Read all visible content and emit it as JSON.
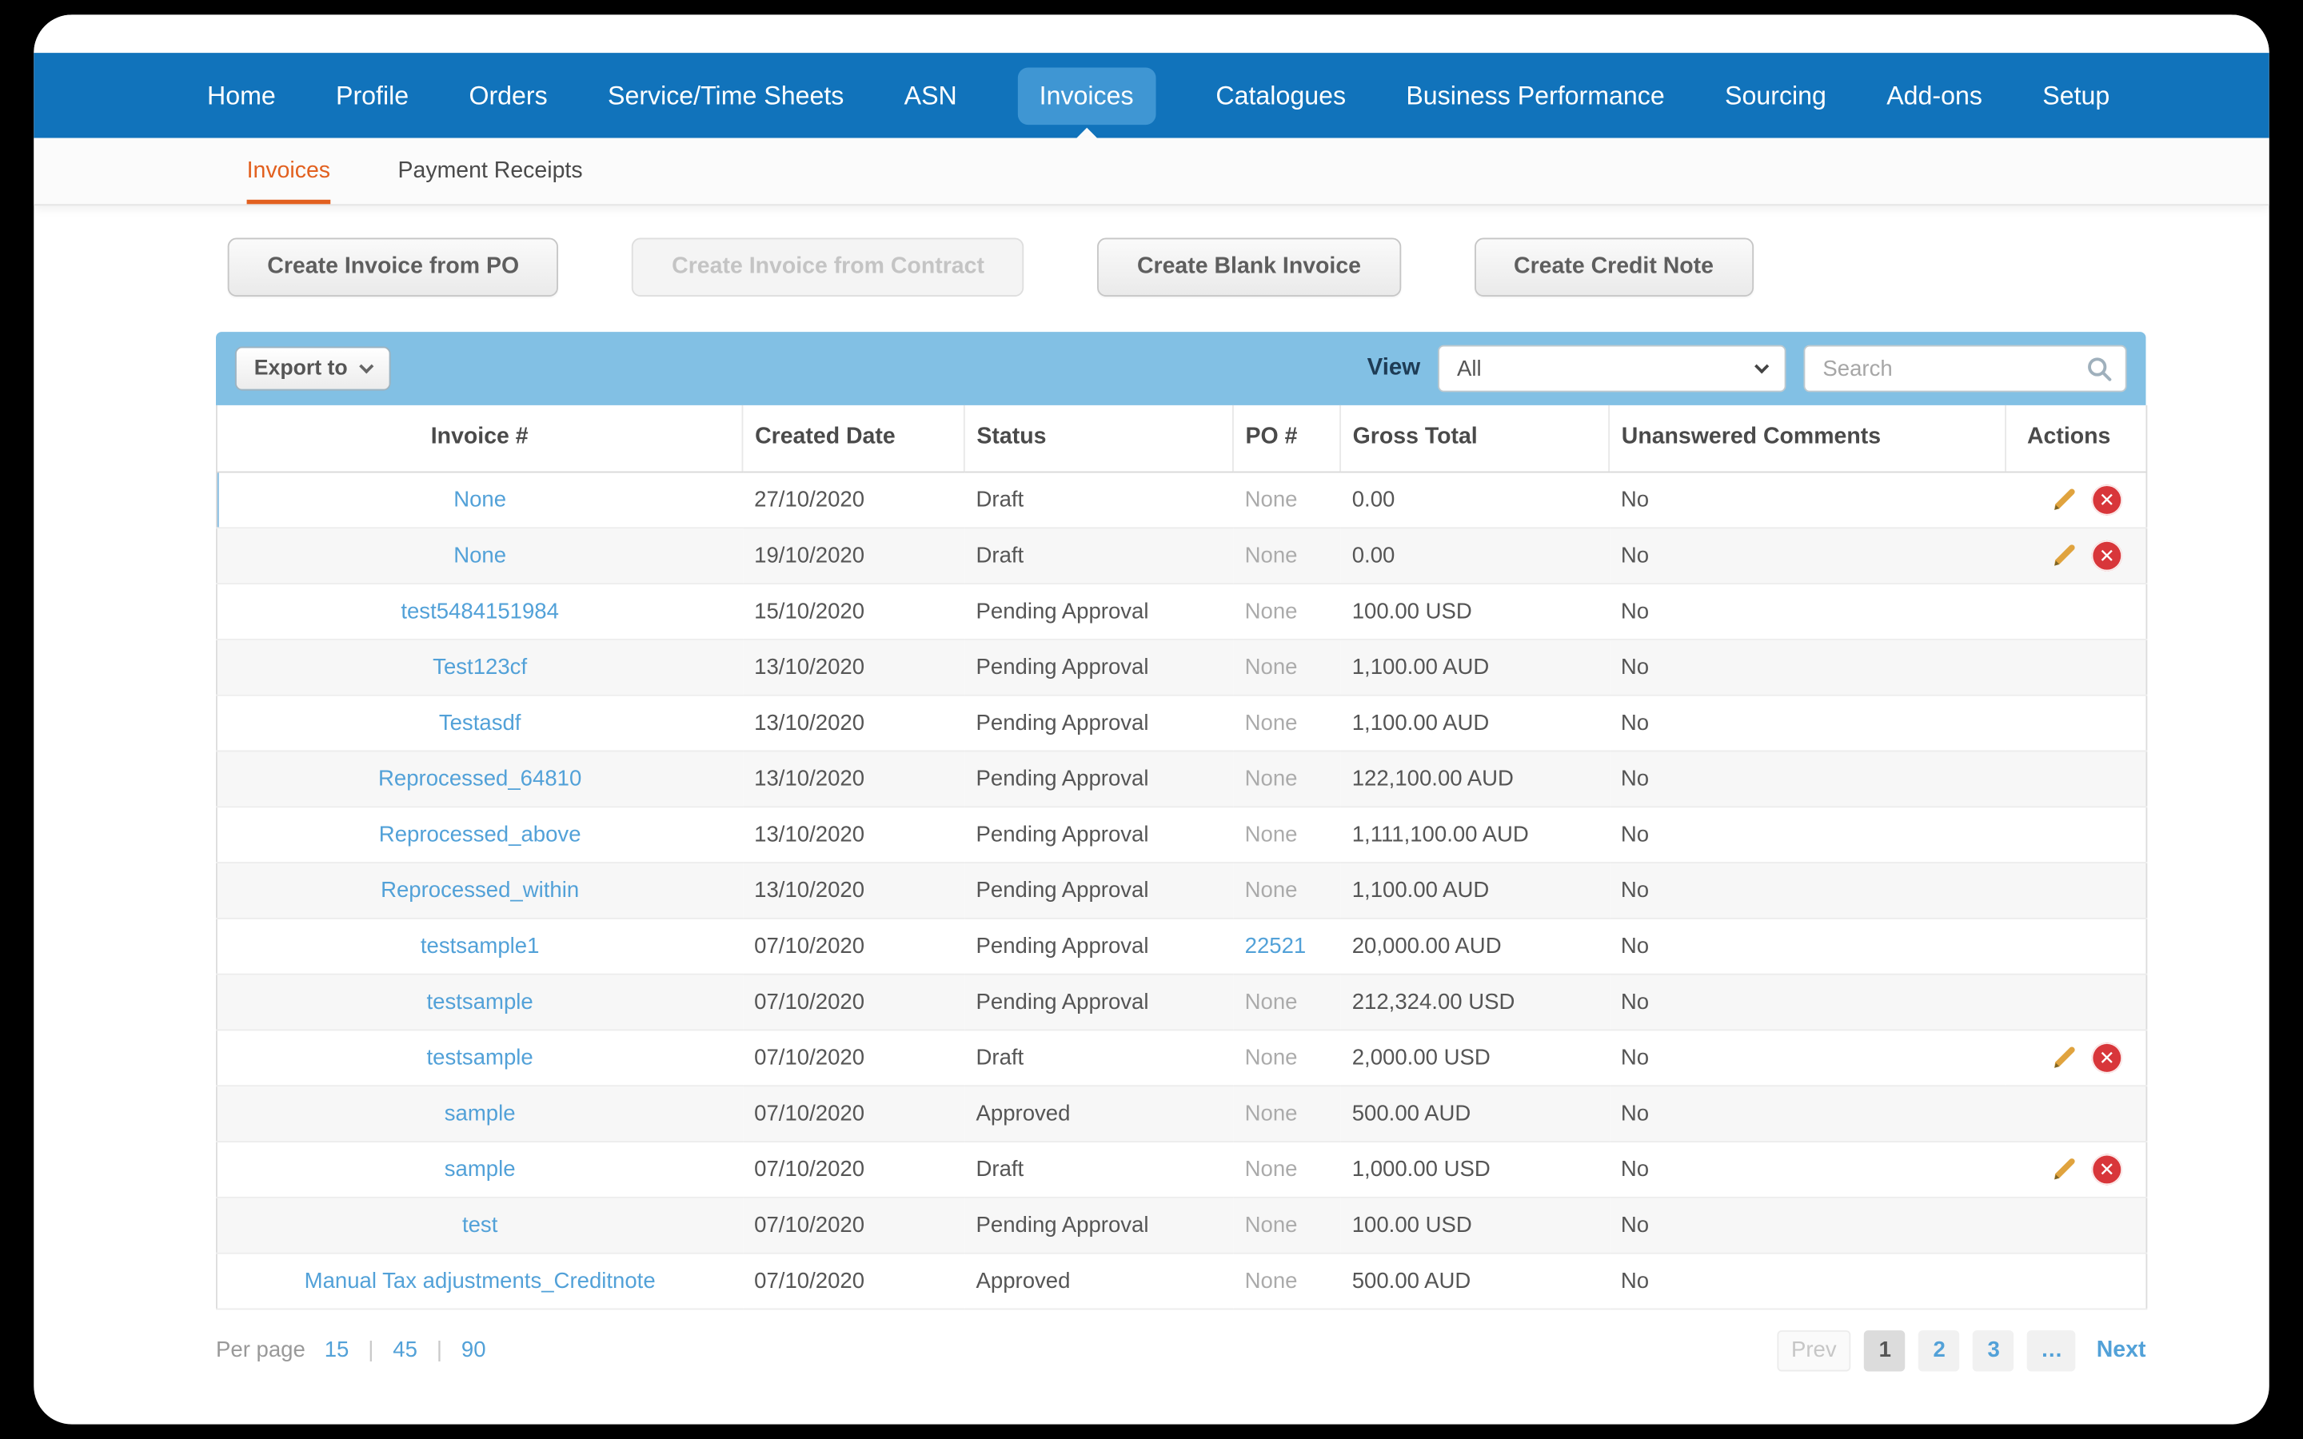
{
  "colors": {
    "nav_blue": "#1173BB",
    "nav_active_blue": "#3F96D3",
    "subnav_orange": "#E2601F",
    "link_blue": "#52A1D8",
    "toolbar_blue": "#82C0E4",
    "delete_red": "#D8363A",
    "pencil_gold": "#E0A33E"
  },
  "nav": {
    "items": [
      {
        "label": "Home",
        "active": false
      },
      {
        "label": "Profile",
        "active": false
      },
      {
        "label": "Orders",
        "active": false
      },
      {
        "label": "Service/Time Sheets",
        "active": false
      },
      {
        "label": "ASN",
        "active": false
      },
      {
        "label": "Invoices",
        "active": true
      },
      {
        "label": "Catalogues",
        "active": false
      },
      {
        "label": "Business Performance",
        "active": false
      },
      {
        "label": "Sourcing",
        "active": false
      },
      {
        "label": "Add-ons",
        "active": false
      },
      {
        "label": "Setup",
        "active": false
      }
    ]
  },
  "subnav": {
    "items": [
      {
        "label": "Invoices",
        "active": true
      },
      {
        "label": "Payment Receipts",
        "active": false
      }
    ]
  },
  "action_buttons": [
    {
      "label": "Create Invoice from PO",
      "disabled": false
    },
    {
      "label": "Create Invoice from Contract",
      "disabled": true
    },
    {
      "label": "Create Blank Invoice",
      "disabled": false
    },
    {
      "label": "Create Credit Note",
      "disabled": false
    }
  ],
  "toolbar": {
    "export_label": "Export to",
    "view_label": "View",
    "view_value": "All",
    "search_placeholder": "Search"
  },
  "table": {
    "columns": [
      "Invoice #",
      "Created Date",
      "Status",
      "PO #",
      "Gross Total",
      "Unanswered Comments",
      "Actions"
    ],
    "rows": [
      {
        "invoice": "None",
        "created": "27/10/2020",
        "status": "Draft",
        "po": "None",
        "po_is_link": false,
        "gross": "0.00",
        "comments": "No",
        "has_actions": true,
        "highlighted": true
      },
      {
        "invoice": "None",
        "created": "19/10/2020",
        "status": "Draft",
        "po": "None",
        "po_is_link": false,
        "gross": "0.00",
        "comments": "No",
        "has_actions": true,
        "highlighted": false
      },
      {
        "invoice": "test5484151984",
        "created": "15/10/2020",
        "status": "Pending Approval",
        "po": "None",
        "po_is_link": false,
        "gross": "100.00 USD",
        "comments": "No",
        "has_actions": false,
        "highlighted": false
      },
      {
        "invoice": "Test123cf",
        "created": "13/10/2020",
        "status": "Pending Approval",
        "po": "None",
        "po_is_link": false,
        "gross": "1,100.00 AUD",
        "comments": "No",
        "has_actions": false,
        "highlighted": false
      },
      {
        "invoice": "Testasdf",
        "created": "13/10/2020",
        "status": "Pending Approval",
        "po": "None",
        "po_is_link": false,
        "gross": "1,100.00 AUD",
        "comments": "No",
        "has_actions": false,
        "highlighted": false
      },
      {
        "invoice": "Reprocessed_64810",
        "created": "13/10/2020",
        "status": "Pending Approval",
        "po": "None",
        "po_is_link": false,
        "gross": "122,100.00 AUD",
        "comments": "No",
        "has_actions": false,
        "highlighted": false
      },
      {
        "invoice": "Reprocessed_above",
        "created": "13/10/2020",
        "status": "Pending Approval",
        "po": "None",
        "po_is_link": false,
        "gross": "1,111,100.00 AUD",
        "comments": "No",
        "has_actions": false,
        "highlighted": false
      },
      {
        "invoice": "Reprocessed_within",
        "created": "13/10/2020",
        "status": "Pending Approval",
        "po": "None",
        "po_is_link": false,
        "gross": "1,100.00 AUD",
        "comments": "No",
        "has_actions": false,
        "highlighted": false
      },
      {
        "invoice": "testsample1",
        "created": "07/10/2020",
        "status": "Pending Approval",
        "po": "22521",
        "po_is_link": true,
        "gross": "20,000.00 AUD",
        "comments": "No",
        "has_actions": false,
        "highlighted": false
      },
      {
        "invoice": "testsample",
        "created": "07/10/2020",
        "status": "Pending Approval",
        "po": "None",
        "po_is_link": false,
        "gross": "212,324.00 USD",
        "comments": "No",
        "has_actions": false,
        "highlighted": false
      },
      {
        "invoice": "testsample",
        "created": "07/10/2020",
        "status": "Draft",
        "po": "None",
        "po_is_link": false,
        "gross": "2,000.00 USD",
        "comments": "No",
        "has_actions": true,
        "highlighted": false
      },
      {
        "invoice": "sample",
        "created": "07/10/2020",
        "status": "Approved",
        "po": "None",
        "po_is_link": false,
        "gross": "500.00 AUD",
        "comments": "No",
        "has_actions": false,
        "highlighted": false
      },
      {
        "invoice": "sample",
        "created": "07/10/2020",
        "status": "Draft",
        "po": "None",
        "po_is_link": false,
        "gross": "1,000.00 USD",
        "comments": "No",
        "has_actions": true,
        "highlighted": false
      },
      {
        "invoice": "test",
        "created": "07/10/2020",
        "status": "Pending Approval",
        "po": "None",
        "po_is_link": false,
        "gross": "100.00 USD",
        "comments": "No",
        "has_actions": false,
        "highlighted": false
      },
      {
        "invoice": "Manual Tax adjustments_Creditnote",
        "created": "07/10/2020",
        "status": "Approved",
        "po": "None",
        "po_is_link": false,
        "gross": "500.00 AUD",
        "comments": "No",
        "has_actions": false,
        "highlighted": false
      }
    ]
  },
  "pagination": {
    "per_page_label": "Per page",
    "per_page_options": [
      "15",
      "45",
      "90"
    ],
    "separator": "|",
    "prev_label": "Prev",
    "pages": [
      "1",
      "2",
      "3"
    ],
    "current_page": "1",
    "ellipsis": "…",
    "next_label": "Next"
  }
}
